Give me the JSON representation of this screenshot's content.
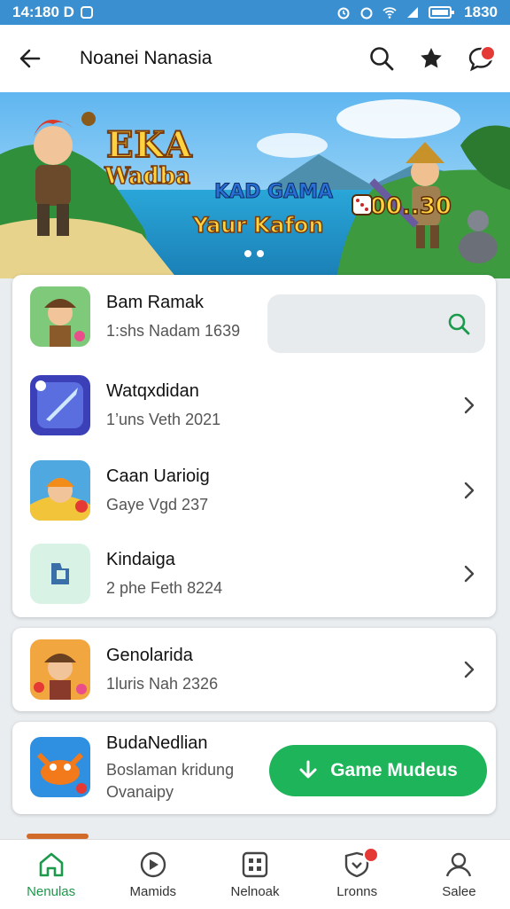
{
  "status": {
    "left_text": "14:180 D",
    "time": "1830"
  },
  "appbar": {
    "title": "Noanei Nanasia"
  },
  "banner": {
    "title1": "EKA",
    "title2": "Wadba",
    "sub1": "KAD GAMA",
    "sub2": "Yaur Kafon",
    "coins": "+00..30"
  },
  "list1": [
    {
      "name": "Bam Ramak",
      "meta": "1:ѕhs Nadam 1639",
      "icon": "explorer-game-icon"
    },
    {
      "name": "Watqxdidan",
      "meta": "1’uns Veth 2021",
      "icon": "sword-game-icon"
    },
    {
      "name": "Caan Uarioig",
      "meta": "Gaye Vgd 237",
      "icon": "builder-game-icon"
    },
    {
      "name": "Kindaiga",
      "meta": "2 phe Feth 8224",
      "icon": "flag-game-icon"
    }
  ],
  "list2": {
    "name": "Genolarida",
    "meta": "1luris Nah 2326",
    "icon": "adventurer-game-icon"
  },
  "list3": {
    "name": "BudaNedlian",
    "meta": "Boslaman kridung",
    "meta2": "Ovanaipy",
    "icon": "crab-game-icon",
    "cta": "Game Mudeus"
  },
  "nav": [
    {
      "label": "Nenulas",
      "icon": "home-icon",
      "active": true
    },
    {
      "label": "Mamids",
      "icon": "compass-icon"
    },
    {
      "label": "Nelnoak",
      "icon": "grid-icon"
    },
    {
      "label": "Lronns",
      "icon": "shield-icon"
    },
    {
      "label": "Salee",
      "icon": "profile-icon"
    }
  ],
  "colors": {
    "accent": "#1db45a",
    "statusbar": "#3a8fd0",
    "badge": "#e53935"
  }
}
